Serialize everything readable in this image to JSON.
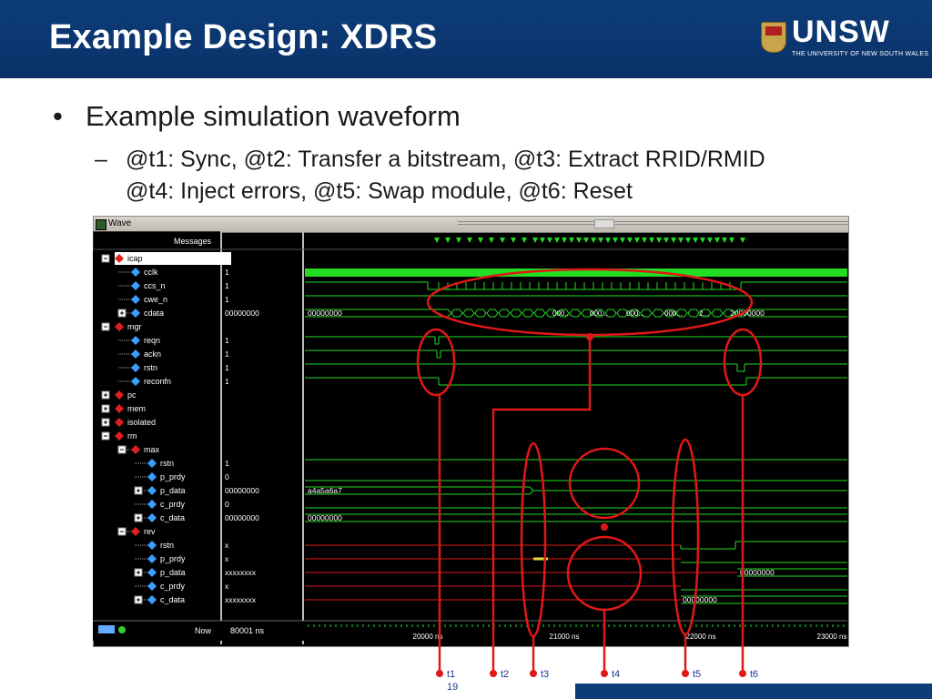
{
  "slide": {
    "title": "Example Design: XDRS",
    "logo_text": "UNSW",
    "logo_sub": "THE UNIVERSITY OF NEW SOUTH WALES",
    "bullet": "Example simulation waveform",
    "sub_line1": "@t1: Sync, @t2: Transfer a bitstream, @t3: Extract RRID/RMID",
    "sub_line2": "@t4: Inject errors, @t5: Swap module, @t6: Reset",
    "page_number": "19"
  },
  "wave": {
    "window_title": "Wave",
    "messages_header": "Messages",
    "now_label": "Now",
    "now_value": "80001 ns",
    "signals": [
      {
        "name": "icap",
        "value": "",
        "expander": "minus",
        "depth": 0,
        "group": true
      },
      {
        "name": "cclk",
        "value": "1",
        "depth": 1
      },
      {
        "name": "ccs_n",
        "value": "1",
        "depth": 1
      },
      {
        "name": "cwe_n",
        "value": "1",
        "depth": 1
      },
      {
        "name": "cdata",
        "value": "00000000",
        "depth": 1,
        "expander": "plus"
      },
      {
        "name": "mgr",
        "value": "",
        "expander": "minus",
        "depth": 0,
        "group": true
      },
      {
        "name": "reqn",
        "value": "1",
        "depth": 1
      },
      {
        "name": "ackn",
        "value": "1",
        "depth": 1
      },
      {
        "name": "rstn",
        "value": "1",
        "depth": 1
      },
      {
        "name": "reconfn",
        "value": "1",
        "depth": 1
      },
      {
        "name": "pc",
        "value": "",
        "expander": "plus",
        "depth": 0,
        "group": true
      },
      {
        "name": "mem",
        "value": "",
        "expander": "plus",
        "depth": 0,
        "group": true
      },
      {
        "name": "isolated",
        "value": "",
        "expander": "plus",
        "depth": 0,
        "group": true
      },
      {
        "name": "rm",
        "value": "",
        "expander": "minus",
        "depth": 0,
        "group": true
      },
      {
        "name": "max",
        "value": "",
        "expander": "minus",
        "depth": 1,
        "group": true
      },
      {
        "name": "rstn",
        "value": "1",
        "depth": 2
      },
      {
        "name": "p_prdy",
        "value": "0",
        "depth": 2
      },
      {
        "name": "p_data",
        "value": "00000000",
        "depth": 2,
        "expander": "plus"
      },
      {
        "name": "c_prdy",
        "value": "0",
        "depth": 2
      },
      {
        "name": "c_data",
        "value": "00000000",
        "depth": 2,
        "expander": "plus"
      },
      {
        "name": "rev",
        "value": "",
        "expander": "minus",
        "depth": 1,
        "group": true
      },
      {
        "name": "rstn",
        "value": "x",
        "depth": 2
      },
      {
        "name": "p_prdy",
        "value": "x",
        "depth": 2
      },
      {
        "name": "p_data",
        "value": "xxxxxxxx",
        "depth": 2,
        "expander": "plus"
      },
      {
        "name": "c_prdy",
        "value": "x",
        "depth": 2
      },
      {
        "name": "c_data",
        "value": "xxxxxxxx",
        "depth": 2,
        "expander": "plus"
      }
    ],
    "trace_texts": {
      "cdata_start": "00000000",
      "cdata_mid": [
        "000...",
        "000...",
        "000...",
        "000...",
        "2..."
      ],
      "cdata_end": "20000000",
      "max_p_data": "a4a5a6a7",
      "max_c_data": "00000000",
      "rev_p_data_end": "00000000",
      "rev_c_data_end": "00000000"
    },
    "time_ticks": [
      "20000 ns",
      "21000 ns",
      "22000 ns",
      "23000 ns"
    ],
    "markers": [
      "t1",
      "t2",
      "t3",
      "t4",
      "t5",
      "t6"
    ]
  },
  "colors": {
    "header_blue": "#0d3d78",
    "wave_green": "#22dd22",
    "wave_red": "#e01818",
    "annotation_red": "#e01818"
  }
}
